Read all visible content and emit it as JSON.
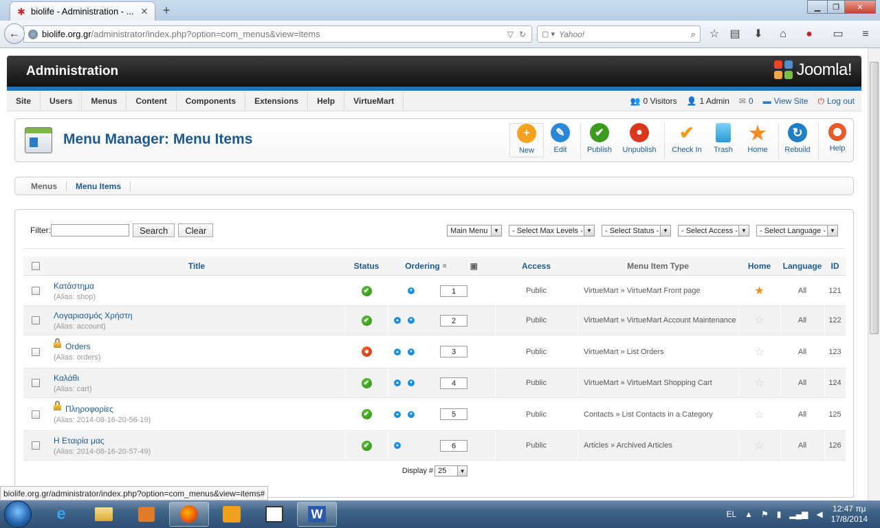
{
  "browser": {
    "tab_title": "biolife - Administration - ...",
    "url_domain": "biolife.org.gr",
    "url_path": "/administrator/index.php?option=com_menus&view=items",
    "search_placeholder": "Yahoo!",
    "status_link": "biolife.org.gr/administrator/index.php?option=com_menus&view=items#"
  },
  "header": {
    "title": "Administration",
    "logo_text": "Joomla!"
  },
  "menubar": {
    "items": [
      "Site",
      "Users",
      "Menus",
      "Content",
      "Components",
      "Extensions",
      "Help",
      "VirtueMart"
    ],
    "visitors": "0 Visitors",
    "admins": "1 Admin",
    "messages": "0",
    "view_site": "View Site",
    "logout": "Log out"
  },
  "toolbar": {
    "page_title": "Menu Manager: Menu Items",
    "buttons": [
      {
        "label": "New",
        "icon": "plus-icon",
        "color": "#f6a21e"
      },
      {
        "label": "Edit",
        "icon": "pencil-icon",
        "color": "#2b88d8"
      },
      {
        "label": "Publish",
        "icon": "check-icon",
        "color": "#3a9b1f"
      },
      {
        "label": "Unpublish",
        "icon": "stop-icon",
        "color": "#d9381e"
      },
      {
        "label": "Check In",
        "icon": "checkmark-icon",
        "color": "#f29a1e"
      },
      {
        "label": "Trash",
        "icon": "trash-icon",
        "color": "#3aa9e2"
      },
      {
        "label": "Home",
        "icon": "star-icon",
        "color": "#f28c1e"
      },
      {
        "label": "Rebuild",
        "icon": "refresh-icon",
        "color": "#1f7fc4"
      },
      {
        "label": "Help",
        "icon": "lifebuoy-icon",
        "color": "#e85a2a"
      }
    ]
  },
  "submenu": {
    "items": [
      "Menus",
      "Menu Items"
    ],
    "active": "Menu Items"
  },
  "filters": {
    "label": "Filter:",
    "search_button": "Search",
    "clear_button": "Clear",
    "menu_select": "Main Menu",
    "levels_select": "- Select Max Levels -",
    "status_select": "- Select Status -",
    "access_select": "- Select Access -",
    "language_select": "- Select Language -"
  },
  "table": {
    "columns": {
      "title": "Title",
      "status": "Status",
      "ordering": "Ordering",
      "access": "Access",
      "type": "Menu Item Type",
      "home": "Home",
      "language": "Language",
      "id": "ID"
    },
    "alias_prefix": "(Alias: ",
    "rows": [
      {
        "title": "Κατάστημα",
        "alias": "shop",
        "locked": false,
        "published": true,
        "up": false,
        "down": true,
        "order": "1",
        "access": "Public",
        "type": "VirtueMart » VirtueMart Front page",
        "home": true,
        "language": "All",
        "id": "121"
      },
      {
        "title": "Λογαριασμός Χρήστη",
        "alias": "account",
        "locked": false,
        "published": true,
        "up": true,
        "down": true,
        "order": "2",
        "access": "Public",
        "type": "VirtueMart » VirtueMart Account Maintenance",
        "home": false,
        "language": "All",
        "id": "122"
      },
      {
        "title": "Orders",
        "alias": "orders",
        "locked": true,
        "published": false,
        "up": true,
        "down": true,
        "order": "3",
        "access": "Public",
        "type": "VirtueMart » List Orders",
        "home": false,
        "language": "All",
        "id": "123"
      },
      {
        "title": "Καλάθι",
        "alias": "cart",
        "locked": false,
        "published": true,
        "up": true,
        "down": true,
        "order": "4",
        "access": "Public",
        "type": "VirtueMart » VirtueMart Shopping Cart",
        "home": false,
        "language": "All",
        "id": "124"
      },
      {
        "title": "Πληροφορίες",
        "alias": "2014-08-16-20-56-19",
        "locked": true,
        "published": true,
        "up": true,
        "down": true,
        "order": "5",
        "access": "Public",
        "type": "Contacts » List Contacts in a Category",
        "home": false,
        "language": "All",
        "id": "125"
      },
      {
        "title": "Η Εταιρία μας",
        "alias": "2014-08-16-20-57-49",
        "locked": false,
        "published": true,
        "up": true,
        "down": false,
        "order": "6",
        "access": "Public",
        "type": "Articles » Archived Articles",
        "home": false,
        "language": "All",
        "id": "126"
      }
    ]
  },
  "pagination": {
    "label": "Display #",
    "value": "25"
  },
  "taskbar": {
    "lang": "EL",
    "time": "12:47 πμ",
    "date": "17/8/2014"
  }
}
